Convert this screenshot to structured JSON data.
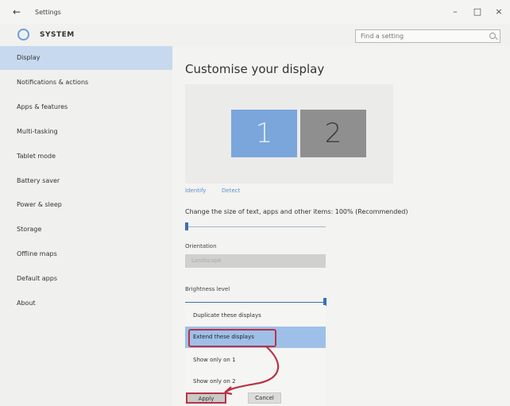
{
  "window": {
    "title": "Settings",
    "back_glyph": "←",
    "minimize_glyph": "–",
    "maximize_glyph": "□",
    "close_glyph": "×"
  },
  "header": {
    "section_title": "SYSTEM",
    "section_icon": "gear-icon",
    "search_placeholder": "Find a setting"
  },
  "sidebar": {
    "items": [
      {
        "label": "Display",
        "selected": true
      },
      {
        "label": "Notifications & actions"
      },
      {
        "label": "Apps & features"
      },
      {
        "label": "Multi-tasking"
      },
      {
        "label": "Tablet mode"
      },
      {
        "label": "Battery saver"
      },
      {
        "label": "Power & sleep"
      },
      {
        "label": "Storage"
      },
      {
        "label": "Offline maps"
      },
      {
        "label": "Default apps"
      },
      {
        "label": "About"
      }
    ]
  },
  "main": {
    "heading": "Customise your display",
    "monitors": [
      "1",
      "2"
    ],
    "identify_link": "Identify",
    "detect_link": "Detect",
    "scale_label": "Change the size of text, apps and other items: 100% (Recommended)",
    "scale_value_percent": 100,
    "orientation_label": "Orientation",
    "orientation_value": "Landscape",
    "brightness_label": "Brightness level",
    "brightness_level_percent": 100,
    "multiple_displays_options": [
      "Duplicate these displays",
      "Extend these displays",
      "Show only on 1",
      "Show only on 2"
    ],
    "selected_option": "Extend these displays",
    "apply_label": "Apply",
    "cancel_label": "Cancel"
  },
  "colors": {
    "accent": "#3d6fb6",
    "monitor_primary": "#7aa6dc",
    "monitor_secondary": "#8f8f8f",
    "selection": "#c6d9ee",
    "annotation": "#b93344"
  }
}
